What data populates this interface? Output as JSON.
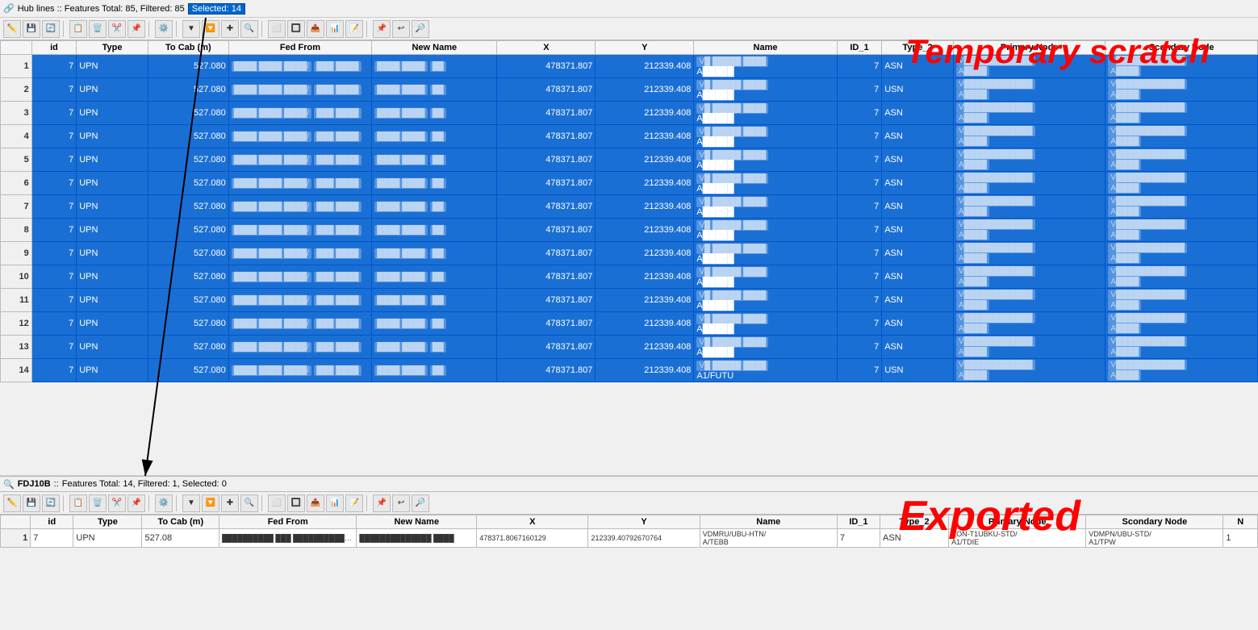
{
  "topbar": {
    "title": "Hub lines :: Features Total: 85, Filtered: 85",
    "selected": "Selected: 14"
  },
  "scratch_label": "Temporary scratch",
  "exported_label": "Exported",
  "columns": [
    "id",
    "Type",
    "To Cab (m)",
    "Fed From",
    "New Name",
    "X",
    "Y",
    "Name",
    "ID_1",
    "Type_2",
    "Primary Node",
    "Scondary Node"
  ],
  "main_rows": [
    {
      "num": 1,
      "id": 7,
      "type": "UPN",
      "tocab": "527.080",
      "x": "478371.807",
      "y": "212339.408",
      "id1": 7,
      "type2": "ASN"
    },
    {
      "num": 2,
      "id": 7,
      "type": "UPN",
      "tocab": "527.080",
      "x": "478371.807",
      "y": "212339.408",
      "id1": 7,
      "type2": "USN"
    },
    {
      "num": 3,
      "id": 7,
      "type": "UPN",
      "tocab": "527.080",
      "x": "478371.807",
      "y": "212339.408",
      "id1": 7,
      "type2": "ASN"
    },
    {
      "num": 4,
      "id": 7,
      "type": "UPN",
      "tocab": "527.080",
      "x": "478371.807",
      "y": "212339.408",
      "id1": 7,
      "type2": "ASN"
    },
    {
      "num": 5,
      "id": 7,
      "type": "UPN",
      "tocab": "527.080",
      "x": "478371.807",
      "y": "212339.408",
      "id1": 7,
      "type2": "ASN"
    },
    {
      "num": 6,
      "id": 7,
      "type": "UPN",
      "tocab": "527.080",
      "x": "478371.807",
      "y": "212339.408",
      "id1": 7,
      "type2": "ASN"
    },
    {
      "num": 7,
      "id": 7,
      "type": "UPN",
      "tocab": "527.080",
      "x": "478371.807",
      "y": "212339.408",
      "id1": 7,
      "type2": "ASN"
    },
    {
      "num": 8,
      "id": 7,
      "type": "UPN",
      "tocab": "527.080",
      "x": "478371.807",
      "y": "212339.408",
      "id1": 7,
      "type2": "ASN"
    },
    {
      "num": 9,
      "id": 7,
      "type": "UPN",
      "tocab": "527.080",
      "x": "478371.807",
      "y": "212339.408",
      "id1": 7,
      "type2": "ASN"
    },
    {
      "num": 10,
      "id": 7,
      "type": "UPN",
      "tocab": "527.080",
      "x": "478371.807",
      "y": "212339.408",
      "id1": 7,
      "type2": "ASN"
    },
    {
      "num": 11,
      "id": 7,
      "type": "UPN",
      "tocab": "527.080",
      "x": "478371.807",
      "y": "212339.408",
      "id1": 7,
      "type2": "ASN"
    },
    {
      "num": 12,
      "id": 7,
      "type": "UPN",
      "tocab": "527.080",
      "x": "478371.807",
      "y": "212339.408",
      "id1": 7,
      "type2": "ASN"
    },
    {
      "num": 13,
      "id": 7,
      "type": "UPN",
      "tocab": "527.080",
      "x": "478371.807",
      "y": "212339.408",
      "id1": 7,
      "type2": "ASN"
    },
    {
      "num": 14,
      "id": 7,
      "type": "UPN",
      "tocab": "527.080",
      "x": "478371.807",
      "y": "212339.408",
      "id1": 7,
      "type2": "USN",
      "name_suffix": "A1/FUTU"
    }
  ],
  "exported_statusbar": {
    "layer": "FDJ10B",
    "stats": "Features Total: 14, Filtered: 1, Selected: 0"
  },
  "bottom_columns": [
    "id",
    "Type",
    "To Cab (m)",
    "Fed From",
    "New Name",
    "X",
    "Y",
    "Name",
    "ID_1",
    "Type_2",
    "Primary Node",
    "Scondary Node",
    "N"
  ],
  "bottom_rows": [
    {
      "num": 1,
      "id": 7,
      "type": "UPN",
      "tocab": "527.08",
      "fedfrom1": "██████████ ███",
      "fedfrom2": "███████████ ████",
      "newname1": "██████████████",
      "newname2": "████",
      "x": "478371.8067160129",
      "y": "212339.40792670764",
      "name1": "VDMRU/UBU-HTN/",
      "name2": "A/TEBB",
      "id1": 7,
      "type2": "ASN",
      "primary1": "KON-T1UBKU-STD/",
      "primary2": "A1/TDIE",
      "secondary1": "VDMPN/UBU-STD/",
      "secondary2": "A1/TPW",
      "extra": "1"
    }
  ],
  "toolbar_buttons": [
    "edit",
    "save",
    "refresh",
    "copy",
    "delete",
    "cut",
    "paste",
    "config",
    "arrow",
    "filter",
    "move",
    "zoom",
    "select1",
    "select2",
    "export",
    "table",
    "edit2",
    "pin",
    "refresh2",
    "zoom2"
  ],
  "toolbar2_buttons": [
    "pencil",
    "save",
    "refresh",
    "copy",
    "delete",
    "cut",
    "paste",
    "config",
    "arrow",
    "filter",
    "move",
    "zoom",
    "select1",
    "select2",
    "export",
    "table",
    "edit2",
    "pin",
    "refresh2",
    "zoom2"
  ]
}
